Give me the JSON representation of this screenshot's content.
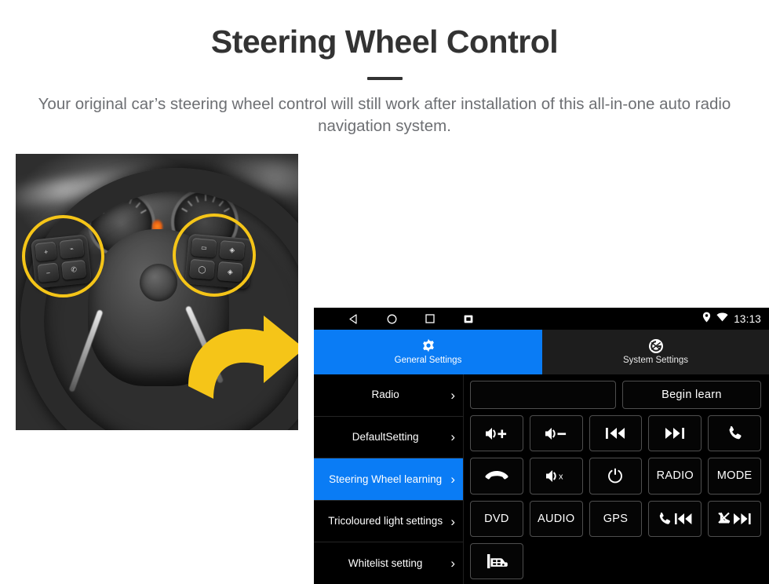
{
  "header": {
    "title": "Steering Wheel Control",
    "subtitle": "Your original car’s steering wheel control will still work after installation of this all-in-one auto radio navigation system."
  },
  "photo": {
    "alt_name": "steering-wheel-photo",
    "highlight_color": "#F5C518",
    "arrow_color": "#F5C518",
    "wheel_keys_left": [
      "+",
      "-",
      "mode",
      "call"
    ],
    "wheel_keys_right": [
      "source",
      "up",
      "enter",
      "down"
    ]
  },
  "headunit": {
    "statusbar": {
      "nav_icons": [
        "back-icon",
        "home-icon",
        "recents-icon",
        "screenshot-icon"
      ],
      "status_icons": [
        "location-icon",
        "wifi-icon"
      ],
      "clock": "13:13"
    },
    "tabs": [
      {
        "label": "General Settings",
        "icon": "gear-icon",
        "active": true
      },
      {
        "label": "System Settings",
        "icon": "system-logo-icon",
        "active": false
      }
    ],
    "accent_color": "#0a7cf5",
    "nav_items": [
      {
        "label": "Radio",
        "selected": false
      },
      {
        "label": "DefaultSetting",
        "selected": false
      },
      {
        "label": "Steering Wheel learning",
        "selected": true
      },
      {
        "label": "Tricoloured light settings",
        "selected": false
      },
      {
        "label": "Whitelist setting",
        "selected": false
      }
    ],
    "learn_field": {
      "value": "",
      "placeholder": ""
    },
    "begin_learn_label": "Begin learn",
    "keys": [
      [
        {
          "type": "icon",
          "icon": "volume-up-icon",
          "label": ""
        },
        {
          "type": "icon",
          "icon": "volume-down-icon",
          "label": ""
        },
        {
          "type": "icon",
          "icon": "previous-track-icon",
          "label": ""
        },
        {
          "type": "icon",
          "icon": "next-track-icon",
          "label": ""
        },
        {
          "type": "icon",
          "icon": "phone-answer-icon",
          "label": ""
        }
      ],
      [
        {
          "type": "icon",
          "icon": "phone-hangup-icon",
          "label": ""
        },
        {
          "type": "icon",
          "icon": "volume-mute-icon",
          "label": ""
        },
        {
          "type": "icon",
          "icon": "power-icon",
          "label": ""
        },
        {
          "type": "text",
          "icon": "",
          "label": "RADIO"
        },
        {
          "type": "text",
          "icon": "",
          "label": "MODE"
        }
      ],
      [
        {
          "type": "text",
          "icon": "",
          "label": "DVD"
        },
        {
          "type": "text",
          "icon": "",
          "label": "AUDIO"
        },
        {
          "type": "text",
          "icon": "",
          "label": "GPS"
        },
        {
          "type": "icon",
          "icon": "phone-previous-icon",
          "label": ""
        },
        {
          "type": "icon",
          "icon": "phone-mute-next-icon",
          "label": ""
        }
      ],
      [
        {
          "type": "icon",
          "icon": "car-icon",
          "label": ""
        }
      ]
    ]
  }
}
